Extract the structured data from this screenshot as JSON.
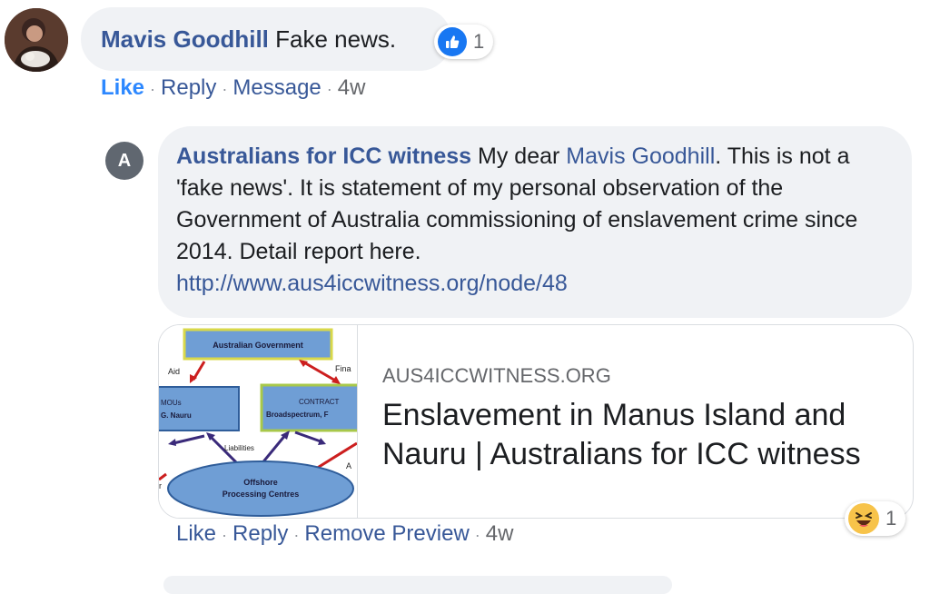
{
  "comment1": {
    "author": "Mavis Goodhill",
    "text": "Fake news.",
    "reaction_count": "1",
    "actions": {
      "like": "Like",
      "reply": "Reply",
      "message": "Message",
      "time": "4w"
    }
  },
  "reply1": {
    "avatar_letter": "A",
    "author": "Australians for ICC witness",
    "text_pre": "My dear",
    "mention": "Mavis Goodhill",
    "text_post": ". This is not a 'fake news'. It is statement of my personal observation of the Government of Australia commissioning of enslavement crime since 2014. Detail report here.",
    "link": "http://www.aus4iccwitness.org/node/48",
    "preview": {
      "domain": "AUS4ICCWITNESS.ORG",
      "title": "Enslavement in Manus Island and Nauru | Australians for ICC witness",
      "thumb": {
        "gov": "Australian Government",
        "aid": "Aid",
        "fina": "Fina",
        "mous1": "MOUs",
        "mous2": "G. Nauru",
        "contract1": "CONTRACT",
        "contract2": "Broadspectrum, F",
        "liabilities": "Liabilities",
        "opc1": "Offshore",
        "opc2": "Processing Centres",
        "a": "A",
        "r": "r"
      }
    },
    "reaction_count": "1",
    "actions": {
      "like": "Like",
      "reply": "Reply",
      "remove": "Remove Preview",
      "time": "4w"
    }
  },
  "colors": {
    "link": "#385898",
    "bubble": "#f0f2f5",
    "like_blue": "#1877f2",
    "haha_yellow": "#f7c34a"
  },
  "icons": {
    "like_reaction": "thumbs-up-icon",
    "haha_reaction": "haha-emoji-icon"
  }
}
